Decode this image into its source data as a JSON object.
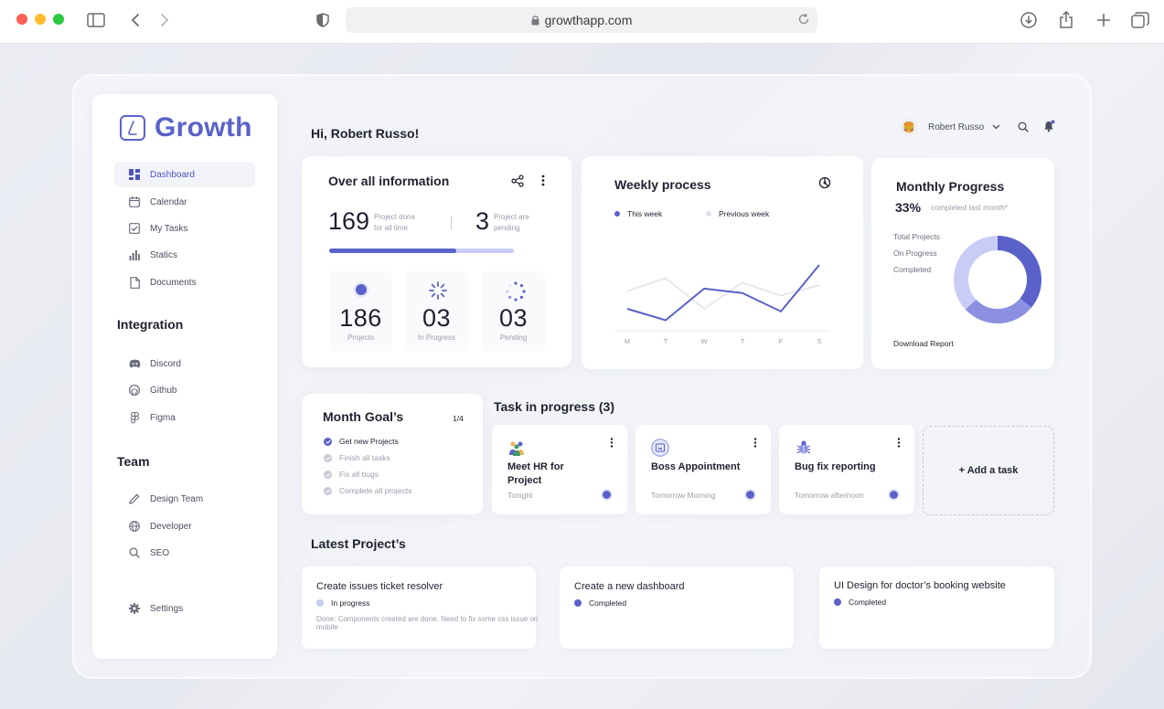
{
  "browser": {
    "url": "growthapp.com"
  },
  "sidebar": {
    "brand": "Growth",
    "nav": [
      {
        "label": "Dashboard",
        "icon": "grid-icon"
      },
      {
        "label": "Calendar",
        "icon": "calendar-icon"
      },
      {
        "label": "My Tasks",
        "icon": "checkbox-icon"
      },
      {
        "label": "Statics",
        "icon": "bar-chart-icon"
      },
      {
        "label": "Documents",
        "icon": "document-icon"
      }
    ],
    "integration_title": "Integration",
    "integrations": [
      {
        "label": "Discord",
        "icon": "discord-icon"
      },
      {
        "label": "Github",
        "icon": "github-icon"
      },
      {
        "label": "Figma",
        "icon": "figma-icon"
      }
    ],
    "team_title": "Team",
    "team": [
      {
        "label": "Design Team",
        "icon": "pen-icon"
      },
      {
        "label": "Developer",
        "icon": "globe-icon"
      },
      {
        "label": "SEO",
        "icon": "search-icon"
      }
    ],
    "settings_label": "Settings"
  },
  "header": {
    "greeting": "Hi, Robert Russo!",
    "user_name": "Robert Russo"
  },
  "overall": {
    "title": "Over all information",
    "done_value": "169",
    "done_label_1": "Project done",
    "done_label_2": "for all time",
    "pending_value": "3",
    "pending_label_1": "Project are",
    "pending_label_2": "pending",
    "progress": 0.69,
    "stats": [
      {
        "value": "186",
        "label": "Projects"
      },
      {
        "value": "03",
        "label": "In Progress"
      },
      {
        "value": "03",
        "label": "Pending"
      }
    ]
  },
  "weekly": {
    "title": "Weekly process",
    "legend_this": "This week",
    "legend_prev": "Previous week"
  },
  "chart_data": {
    "type": "line",
    "title": "Weekly process",
    "categories": [
      "M",
      "T",
      "W",
      "T",
      "F",
      "S"
    ],
    "series": [
      {
        "name": "This week",
        "color": "#5a62c9",
        "values": [
          25,
          12,
          48,
          43,
          22,
          75
        ]
      },
      {
        "name": "Previous week",
        "color": "#e2e3ea",
        "values": [
          45,
          60,
          25,
          55,
          40,
          52
        ]
      }
    ],
    "ylim": [
      0,
      100
    ],
    "grid": false,
    "legend": "top-left"
  },
  "monthly": {
    "title": "Monthly Progress",
    "percent": "33%",
    "percent_caption": "completed last month*",
    "legend": [
      "Total Projects",
      "On Progress",
      "Completed"
    ],
    "download_label": "Download Report",
    "segments": [
      {
        "label": "Completed",
        "value": 0.36,
        "color": "#5a62c9"
      },
      {
        "label": "On Progress",
        "value": 0.27,
        "color": "#8b91e0"
      },
      {
        "label": "Total Projects",
        "value": 0.37,
        "color": "#c9ccf5"
      }
    ]
  },
  "goals": {
    "title": "Month Goal’s",
    "count": "1/4",
    "items": [
      {
        "label": "Get new Projects",
        "done": true
      },
      {
        "label": "Finish all tasks",
        "done": false
      },
      {
        "label": "Fix all bugs",
        "done": false
      },
      {
        "label": "Complete all projects",
        "done": false
      }
    ]
  },
  "tasks": {
    "title": "Task in progress (3)",
    "items": [
      {
        "name": "Meet HR for Project",
        "time": "Tonight",
        "icon": "team-icon"
      },
      {
        "name": "Boss Appointment",
        "time": "Tomorrow Morning",
        "icon": "calendar-icon"
      },
      {
        "name": "Bug fix reporting",
        "time": "Tomorrow afternoon",
        "icon": "bug-icon"
      }
    ],
    "add_label": "+ Add a task"
  },
  "projects": {
    "title": "Latest Project’s",
    "items": [
      {
        "title": "Create issues ticket resolver",
        "status": "In progress",
        "status_color": "#c9ccf5",
        "desc": "Done: Components created are done. Need to fix some css issue on mobile"
      },
      {
        "title": "Create a new dashboard",
        "status": "Completed",
        "status_color": "#5a62c9",
        "desc": ""
      },
      {
        "title": "UI Design for doctor’s booking website",
        "status": "Completed",
        "status_color": "#5a62c9",
        "desc": ""
      }
    ]
  }
}
